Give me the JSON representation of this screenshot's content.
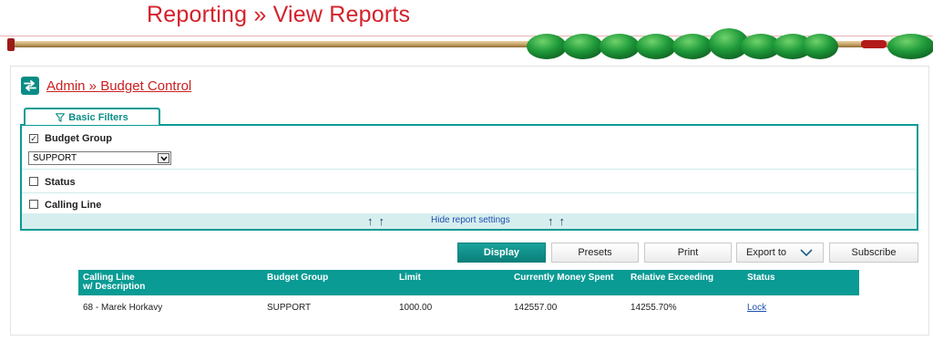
{
  "header": {
    "title": "Reporting » View Reports"
  },
  "breadcrumb": {
    "icon": "switch-arrows-icon",
    "text": "Admin » Budget Control"
  },
  "filters": {
    "tab_label": "Basic Filters",
    "tab_icon": "filter-icon",
    "budget_group": {
      "label": "Budget Group",
      "checked": true,
      "selected": "SUPPORT"
    },
    "status": {
      "label": "Status",
      "checked": false
    },
    "calling_line": {
      "label": "Calling Line",
      "checked": false
    },
    "hide_label": "Hide report settings"
  },
  "actions": {
    "display": "Display",
    "presets": "Presets",
    "print": "Print",
    "export": "Export to",
    "subscribe": "Subscribe"
  },
  "table": {
    "headers": {
      "calling_line": "Calling Line",
      "calling_line_sub": "w/ Description",
      "budget_group": "Budget Group",
      "limit": "Limit",
      "money_spent": "Currently Money Spent",
      "relative": "Relative Exceeding",
      "status": "Status"
    },
    "rows": [
      {
        "calling_line": "68 - Marek Horkavy",
        "budget_group": "SUPPORT",
        "limit": "1000.00",
        "money_spent": "142557.00",
        "relative": "14255.70%",
        "status": "Lock"
      }
    ]
  },
  "colors": {
    "brand_red": "#d5212b",
    "teal": "#0a9b94",
    "abacus_green": "#1f9a3a"
  }
}
